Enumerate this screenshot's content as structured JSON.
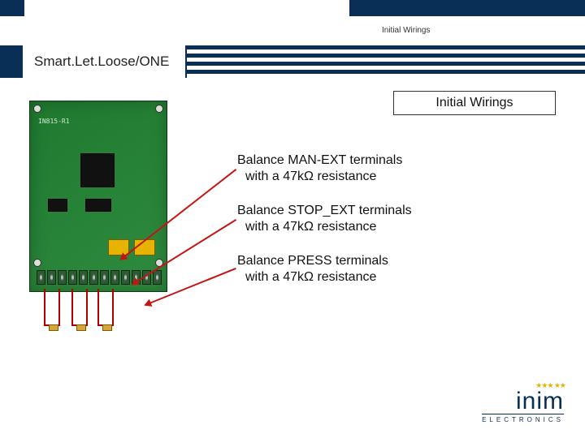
{
  "header": {
    "small_label": "Initial Wirings",
    "product_name": "Smart.Let.Loose/ONE"
  },
  "slide": {
    "title": "Initial Wirings"
  },
  "pcb": {
    "silk_label": "IN815-R1"
  },
  "instructions": [
    {
      "line1": "Balance MAN-EXT terminals",
      "line2": "with a 47kΩ resistance"
    },
    {
      "line1": "Balance STOP_EXT terminals",
      "line2": "with a 47kΩ resistance"
    },
    {
      "line1": "Balance PRESS terminals",
      "line2": "with a 47kΩ resistance"
    }
  ],
  "logo": {
    "brand": "inim",
    "sub": "ELECTRONICS"
  }
}
